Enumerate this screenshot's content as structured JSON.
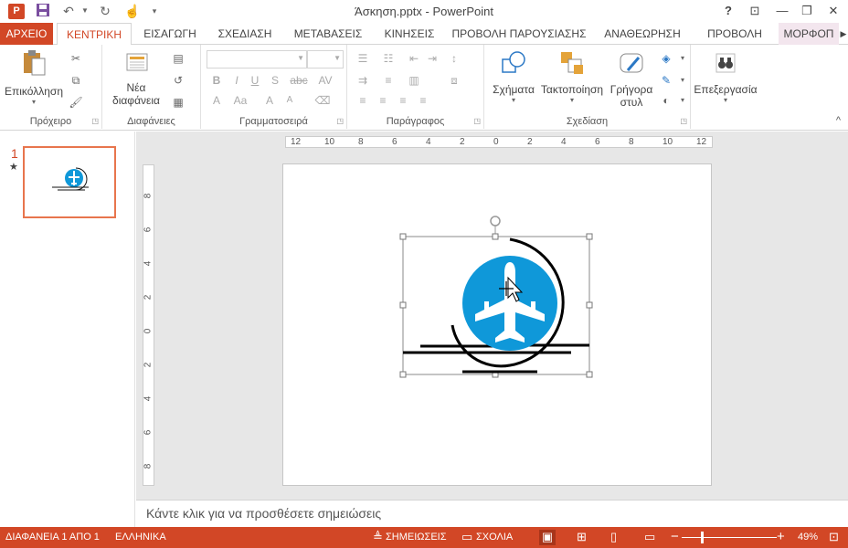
{
  "window": {
    "title": "Άσκηση.pptx - PowerPoint",
    "app_logo": "P",
    "qat": [
      "save-icon",
      "undo-icon",
      "redo-icon",
      "touch-mode-icon",
      "customize-icon"
    ],
    "controls": {
      "help": "?",
      "ribbon_options": "⊡",
      "minimize": "—",
      "restore": "❐",
      "close": "✕"
    }
  },
  "tabs": [
    {
      "label": "ΑΡΧΕΙΟ"
    },
    {
      "label": "ΚΕΝΤΡΙΚΗ"
    },
    {
      "label": "ΕΙΣΑΓΩΓΗ"
    },
    {
      "label": "ΣΧΕΔΙΑΣΗ"
    },
    {
      "label": "ΜΕΤΑΒΑΣΕΙΣ"
    },
    {
      "label": "ΚΙΝΗΣΕΙΣ"
    },
    {
      "label": "ΠΡΟΒΟΛΗ ΠΑΡΟΥΣΙΑΣΗΣ"
    },
    {
      "label": "ΑΝΑΘΕΩΡΗΣΗ"
    },
    {
      "label": "ΠΡΟΒΟΛΗ"
    },
    {
      "label": "ΜΟΡΦΟΠ"
    }
  ],
  "ribbon": {
    "clipboard": {
      "label": "Πρόχειρο",
      "paste": "Επικόλληση"
    },
    "slides": {
      "label": "Διαφάνειες",
      "new_slide_line1": "Νέα",
      "new_slide_line2": "διαφάνεια"
    },
    "font": {
      "label": "Γραμματοσειρά",
      "bold": "B",
      "italic": "I",
      "underline": "U",
      "strike": "S",
      "abc": "abc",
      "spacing": "AV",
      "case": "Aa",
      "color": "A"
    },
    "paragraph": {
      "label": "Παράγραφος"
    },
    "drawing": {
      "label": "Σχεδίαση",
      "shapes": "Σχήματα",
      "arrange": "Τακτοποίηση",
      "quick_styles_line1": "Γρήγορα",
      "quick_styles_line2": "στυλ"
    },
    "editing": {
      "label": "Επεξεργασία"
    }
  },
  "thumbnails": {
    "slide_number": "1",
    "star": "★"
  },
  "rulers": {
    "horizontal": [
      "12",
      "10",
      "8",
      "6",
      "4",
      "2",
      "0",
      "2",
      "4",
      "6",
      "8",
      "10",
      "12"
    ],
    "vertical": [
      "8",
      "6",
      "4",
      "2",
      "0",
      "2",
      "4",
      "6",
      "8"
    ]
  },
  "notes": {
    "placeholder": "Κάντε κλικ για να προσθέσετε σημειώσεις"
  },
  "status": {
    "slide_info": "ΔΙΑΦΑΝΕΙΑ 1 ΑΠΟ 1",
    "language": "ΕΛΛΗΝΙΚΑ",
    "notes": "ΣΗΜΕΙΩΣΕΙΣ",
    "comments": "ΣΧΟΛΙΑ",
    "zoom": "49%",
    "zoom_minus": "−",
    "zoom_plus": "+"
  },
  "colors": {
    "accent": "#d24726",
    "logo_blue": "#0f98d9"
  }
}
